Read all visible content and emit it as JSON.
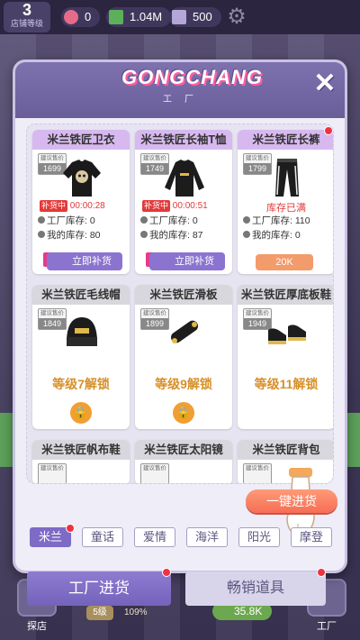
{
  "topbar": {
    "level_num": "3",
    "level_label": "店铺等级",
    "gems": "0",
    "cash": "1.04M",
    "tickets": "500"
  },
  "colors": {
    "accent": "#7d6bc6",
    "header": "#6a5e99",
    "alert": "#e23a3a",
    "lock": "#d7902b"
  },
  "modal": {
    "brand_title": "GONGCHANG",
    "brand_sub": "工厂"
  },
  "products": [
    {
      "name": "米兰铁匠卫衣",
      "price_label": "建议售价",
      "price": "1699",
      "restock_badge": "补货中",
      "timer": "00:00:28",
      "factory_stock_label": "工厂库存:",
      "factory_stock": "0",
      "my_stock_label": "我的库存:",
      "my_stock": "80",
      "action": "立即补货",
      "icon": "hoodie-icon"
    },
    {
      "name": "米兰铁匠长袖T恤",
      "price_label": "建议售价",
      "price": "1749",
      "restock_badge": "补货中",
      "timer": "00:00:51",
      "factory_stock_label": "工厂库存:",
      "factory_stock": "0",
      "my_stock_label": "我的库存:",
      "my_stock": "87",
      "action": "立即补货",
      "icon": "longsleeve-icon"
    },
    {
      "name": "米兰铁匠长裤",
      "price_label": "建议售价",
      "price": "1799",
      "full_text": "库存已满",
      "factory_stock_label": "工厂库存:",
      "factory_stock": "110",
      "my_stock_label": "我的库存:",
      "my_stock": "0",
      "action": "20K",
      "icon": "pants-icon"
    },
    {
      "name": "米兰铁匠毛线帽",
      "price_label": "建议售价",
      "price": "1849",
      "unlock_text": "等级7解锁",
      "icon": "beanie-icon"
    },
    {
      "name": "米兰铁匠滑板",
      "price_label": "建议售价",
      "price": "1899",
      "unlock_text": "等级9解锁",
      "icon": "skateboard-icon"
    },
    {
      "name": "米兰铁匠厚底板鞋",
      "price_label": "建议售价",
      "price": "1949",
      "unlock_text": "等级11解锁",
      "icon": "sneakers-icon"
    },
    {
      "name": "米兰铁匠帆布鞋",
      "price_label": "建议售价"
    },
    {
      "name": "米兰铁匠太阳镜",
      "price_label": "建议售价"
    },
    {
      "name": "米兰铁匠背包",
      "price_label": "建议售价"
    }
  ],
  "bulk_button": "一键进货",
  "categories": [
    "米兰",
    "童话",
    "爱情",
    "海洋",
    "阳光",
    "摩登"
  ],
  "bottom_tabs": {
    "factory": "工厂进货",
    "bestseller": "畅销道具"
  },
  "nav": {
    "store": "探店",
    "factory": "工厂"
  },
  "background": {
    "chip1": "5级",
    "chip2": "109%",
    "chip3": "35.8K"
  }
}
